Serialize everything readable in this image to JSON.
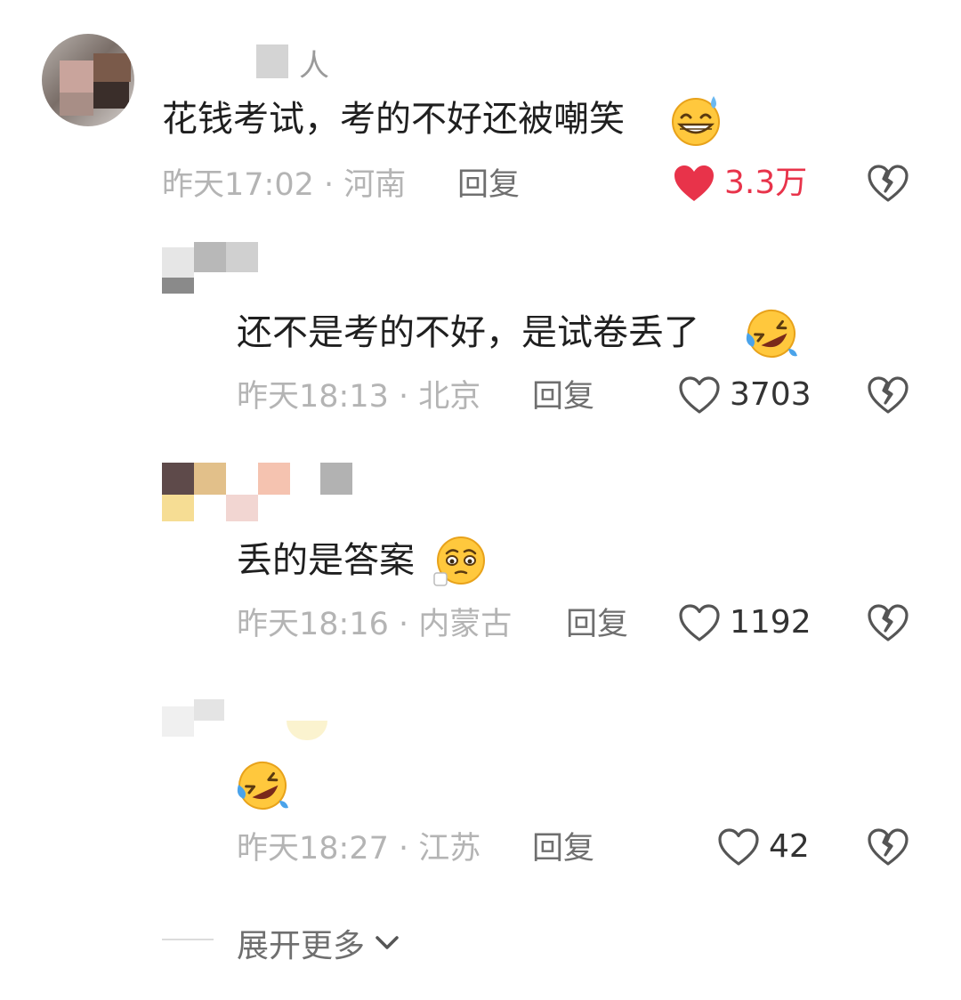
{
  "comments": [
    {
      "username": "人",
      "text": "花钱考试，考的不好还被嘲笑",
      "emoji": "grinning-sweat-emoji",
      "time": "昨天17:02",
      "separator": "·",
      "location": "河南",
      "reply": "回复",
      "likes": "3.3万",
      "liked": true
    },
    {
      "username": "",
      "text": "还不是考的不好，是试卷丢了",
      "emoji": "rolling-laughing-emoji",
      "time": "昨天18:13",
      "separator": "·",
      "location": "北京",
      "reply": "回复",
      "likes": "3703",
      "liked": false
    },
    {
      "username": "",
      "text": "丢的是答案",
      "emoji": "pleading-emoji",
      "time": "昨天18:16",
      "separator": "·",
      "location": "内蒙古",
      "reply": "回复",
      "likes": "1192",
      "liked": false
    },
    {
      "username": "",
      "text": "",
      "emoji": "rolling-laughing-emoji",
      "time": "昨天18:27",
      "separator": "·",
      "location": "江苏",
      "reply": "回复",
      "likes": "42",
      "liked": false
    }
  ],
  "expand_more": "展开更多",
  "colors": {
    "liked_red": "#e8334a",
    "meta_gray": "#b4b4b4",
    "reply_gray": "#6f6f6f",
    "text": "#1f1f1f"
  }
}
